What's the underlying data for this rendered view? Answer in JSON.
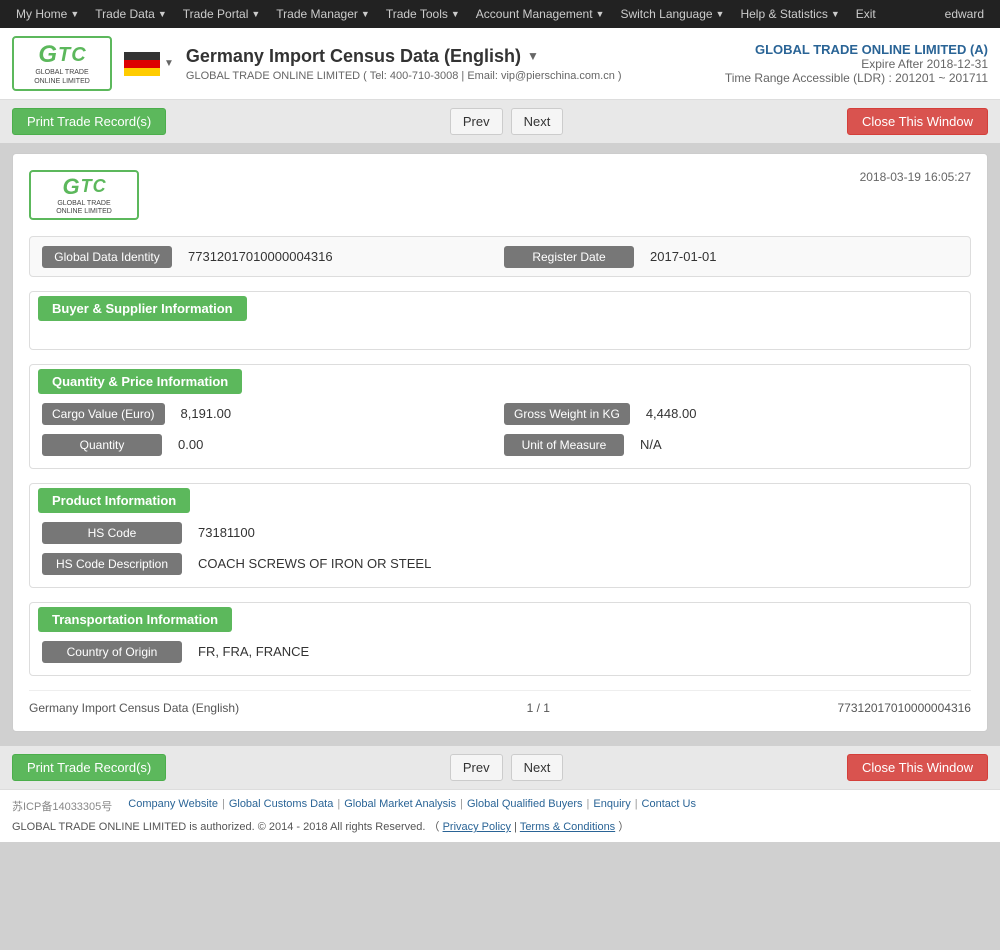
{
  "topnav": {
    "items": [
      "My Home",
      "Trade Data",
      "Trade Portal",
      "Trade Manager",
      "Trade Tools",
      "Account Management",
      "Switch Language",
      "Help & Statistics",
      "Exit"
    ],
    "user": "edward"
  },
  "header": {
    "logo_line1": "GLOBAL TRADE ONLINE LIMITED",
    "flag_alt": "Germany",
    "page_title": "Germany Import Census Data (English)",
    "subtitle": "GLOBAL TRADE ONLINE LIMITED ( Tel: 400-710-3008 | Email: vip@pierschina.com.cn )",
    "company_name": "GLOBAL TRADE ONLINE LIMITED (A)",
    "expire": "Expire After 2018-12-31",
    "time_range": "Time Range Accessible (LDR) : 201201 ~ 201711"
  },
  "toolbar": {
    "print_label": "Print Trade Record(s)",
    "prev_label": "Prev",
    "next_label": "Next",
    "close_label": "Close This Window"
  },
  "record": {
    "timestamp": "2018-03-19 16:05:27",
    "global_data_identity_label": "Global Data Identity",
    "global_data_identity_value": "77312017010000004316",
    "register_date_label": "Register Date",
    "register_date_value": "2017-01-01",
    "sections": {
      "buyer_supplier": {
        "title": "Buyer & Supplier Information",
        "fields": []
      },
      "quantity_price": {
        "title": "Quantity & Price Information",
        "fields": [
          {
            "label": "Cargo Value (Euro)",
            "value": "8,191.00",
            "col": "left"
          },
          {
            "label": "Gross Weight in KG",
            "value": "4,448.00",
            "col": "right"
          },
          {
            "label": "Quantity",
            "value": "0.00",
            "col": "left"
          },
          {
            "label": "Unit of Measure",
            "value": "N/A",
            "col": "right"
          }
        ]
      },
      "product": {
        "title": "Product Information",
        "fields": [
          {
            "label": "HS Code",
            "value": "73181100"
          },
          {
            "label": "HS Code Description",
            "value": "COACH SCREWS OF IRON OR STEEL"
          }
        ]
      },
      "transportation": {
        "title": "Transportation Information",
        "fields": [
          {
            "label": "Country of Origin",
            "value": "FR, FRA, FRANCE"
          }
        ]
      }
    },
    "footer": {
      "title": "Germany Import Census Data (English)",
      "page": "1 / 1",
      "id": "77312017010000004316"
    }
  },
  "footer": {
    "icp": "苏ICP备14033305号",
    "links": [
      "Company Website",
      "Global Customs Data",
      "Global Market Analysis",
      "Global Qualified Buyers",
      "Enquiry",
      "Contact Us"
    ],
    "copyright": "GLOBAL TRADE ONLINE LIMITED is authorized. © 2014 - 2018 All rights Reserved.  （",
    "privacy": "Privacy Policy",
    "separator1": "|",
    "terms": "Terms & Conditions",
    "copyright_end": "）"
  }
}
